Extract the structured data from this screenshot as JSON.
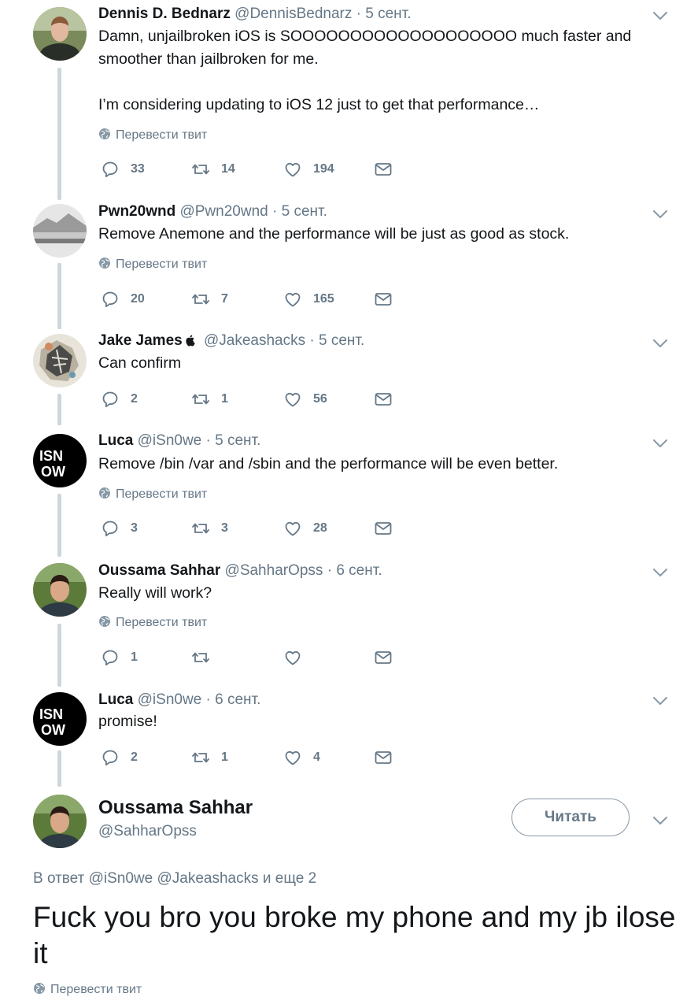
{
  "translate_label": "Перевести твит",
  "tweets": [
    {
      "name": "Dennis D. Bednarz",
      "handle": "@DennisBednarz",
      "date": "5 сент.",
      "text": "Damn, unjailbroken iOS is SOOOOOOOOOOOOOOOOOOO much faster and smoother than jailbroken for me.\n\nI’m considering updating to iOS 12 just to get that performance…",
      "replies": "33",
      "retweets": "14",
      "likes": "194"
    },
    {
      "name": "Pwn20wnd",
      "handle": "@Pwn20wnd",
      "date": "5 сент.",
      "text": "Remove Anemone and the performance will be just as good as stock.",
      "replies": "20",
      "retweets": "7",
      "likes": "165"
    },
    {
      "name": "Jake James",
      "handle": "@Jakeashacks",
      "date": "5 сент.",
      "text": "Can confirm",
      "replies": "2",
      "retweets": "1",
      "likes": "56"
    },
    {
      "name": "Luca",
      "handle": "@iSn0we",
      "date": "5 сент.",
      "text": "Remove /bin /var and /sbin and the performance will be even better.",
      "replies": "3",
      "retweets": "3",
      "likes": "28"
    },
    {
      "name": "Oussama Sahhar",
      "handle": "@SahharOpss",
      "date": "6 сент.",
      "text": "Really will work?",
      "replies": "1",
      "retweets": "",
      "likes": ""
    },
    {
      "name": "Luca",
      "handle": "@iSn0we",
      "date": "6 сент.",
      "text": "promise!",
      "replies": "2",
      "retweets": "1",
      "likes": "4"
    }
  ],
  "avatar_text": {
    "line1": "ISN",
    "line2": "OW"
  },
  "main": {
    "name": "Oussama Sahhar",
    "handle": "@SahharOpss",
    "follow_label": "Читать",
    "reply_prefix": "В ответ",
    "reply_mention_1": "@iSn0we",
    "reply_mention_2": "@Jakeashacks",
    "reply_suffix": "и еще 2",
    "text": "Fuck you bro you broke my phone and my jb ilose it"
  },
  "colors": {
    "text": "#14171a",
    "secondary": "#657786",
    "thread_line": "#ccd6dd",
    "link": "#657786"
  }
}
